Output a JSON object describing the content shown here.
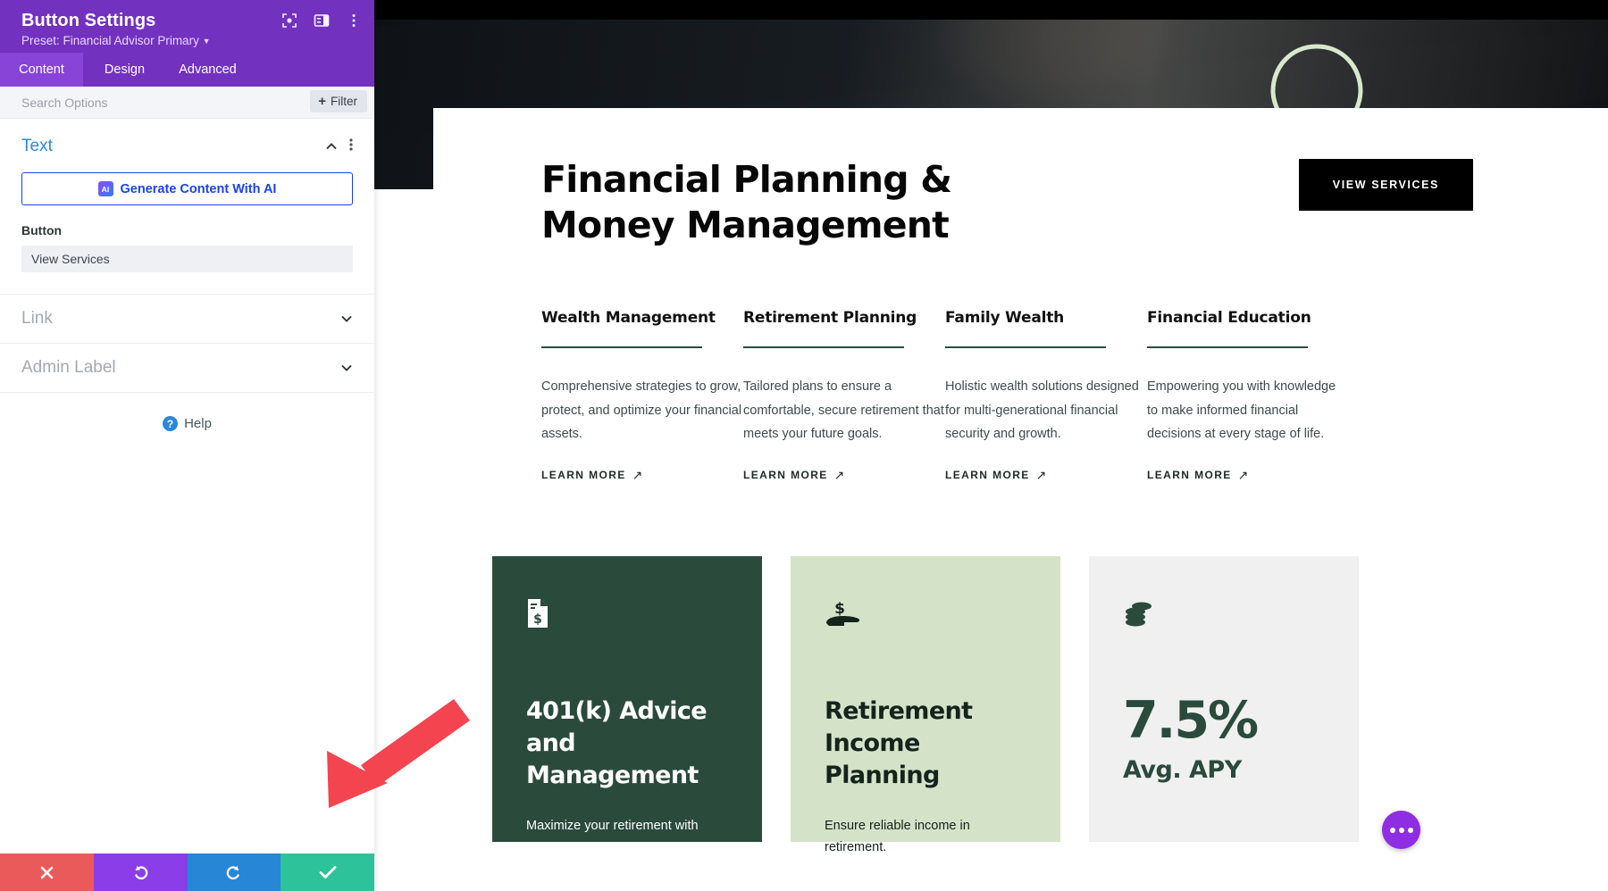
{
  "panel": {
    "title": "Button Settings",
    "preset": "Preset: Financial Advisor Primary",
    "header_icons": [
      "focus-target-icon",
      "panel-layout-icon",
      "vertical-dots-icon"
    ],
    "tabs": [
      {
        "label": "Content",
        "active": true
      },
      {
        "label": "Design",
        "active": false
      },
      {
        "label": "Advanced",
        "active": false
      }
    ],
    "search_placeholder": "Search Options",
    "filter_label": "Filter",
    "sections": [
      {
        "name": "Text",
        "state": "open"
      },
      {
        "name": "Link",
        "state": "closed"
      },
      {
        "name": "Admin Label",
        "state": "closed"
      }
    ],
    "ai_button": "Generate Content With AI",
    "ai_chip": "AI",
    "button_field": {
      "label": "Button",
      "value": "View Services"
    },
    "help": "Help",
    "actions": [
      {
        "name": "cancel",
        "icon": "close-icon",
        "color": "#eb5a5a"
      },
      {
        "name": "undo",
        "icon": "undo-icon",
        "color": "#8b3ee8"
      },
      {
        "name": "redo",
        "icon": "redo-icon",
        "color": "#2786d6"
      },
      {
        "name": "save",
        "icon": "check-icon",
        "color": "#2ec29a"
      }
    ]
  },
  "page": {
    "hero": {
      "title_line1": "Financial Planning &",
      "title_line2": "Money Management",
      "cta": "VIEW SERVICES"
    },
    "services": [
      {
        "title": "Wealth Management",
        "desc": "Comprehensive strategies to grow, protect, and optimize your financial assets.",
        "link": "LEARN MORE"
      },
      {
        "title": "Retirement Planning",
        "desc": "Tailored plans to ensure a comfortable, secure retirement that meets your future goals.",
        "link": "LEARN MORE"
      },
      {
        "title": "Family Wealth",
        "desc": "Holistic wealth solutions designed for multi-generational financial security and growth.",
        "link": "LEARN MORE"
      },
      {
        "title": "Financial Education",
        "desc": "Empowering you with knowledge to make informed financial decisions at every stage of life.",
        "link": "LEARN MORE"
      }
    ],
    "promos": [
      {
        "icon": "document-dollar-icon",
        "title": "401(k) Advice and Management",
        "sub": "Maximize your retirement with"
      },
      {
        "icon": "hand-dollar-icon",
        "title": "Retirement Income Planning",
        "sub": "Ensure reliable income in retirement."
      },
      {
        "icon": "coin-stack-icon",
        "stat_value": "7.5%",
        "stat_label": "Avg. APY"
      }
    ]
  },
  "colors": {
    "panel_purple": "#7331c0",
    "panel_tab_active": "#8744d6",
    "accent_blue": "#2b87da",
    "ai_blue": "#1a44e8",
    "brand_green": "#2a4a3c",
    "promo_light_green": "#d4e3c8",
    "promo_grey": "#f0f0f0",
    "annotation_red": "#f4444f",
    "fab_purple": "#8e2de2"
  }
}
